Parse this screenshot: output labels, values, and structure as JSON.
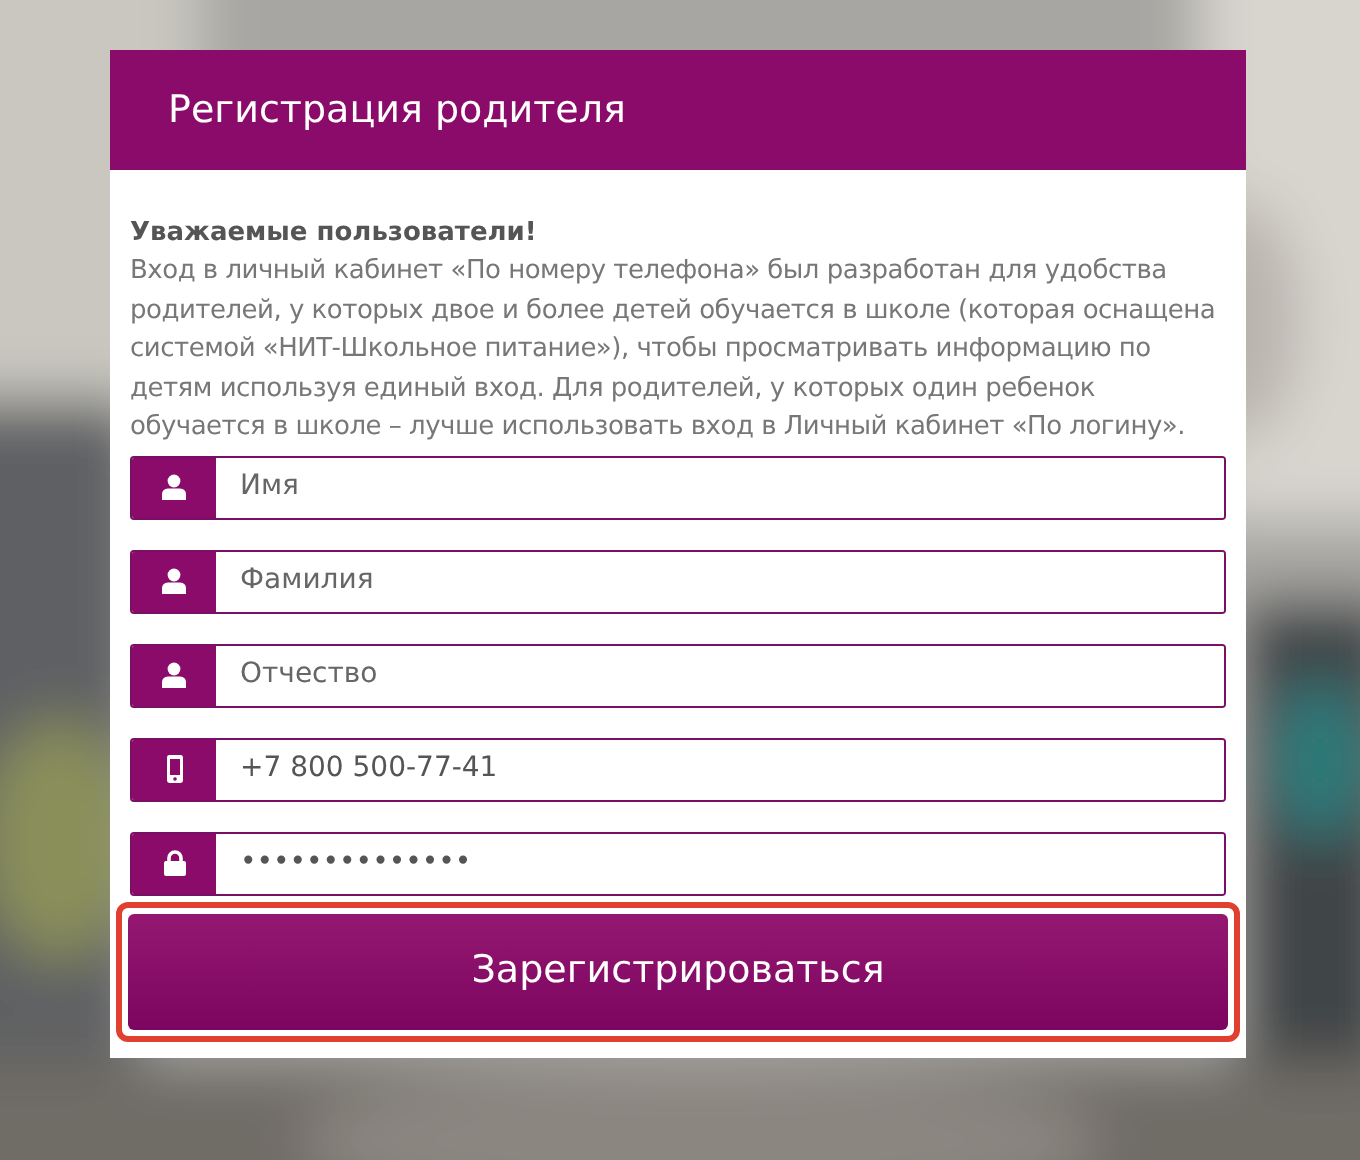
{
  "card": {
    "title": "Регистрация родителя"
  },
  "notice": {
    "heading": "Уважаемые пользователи!",
    "text": "Вход в личный кабинет «По номеру телефона» был разработан для удобства родителей, у которых двое и более детей обучается в школе (которая оснащена системой «НИТ-Школьное питание»), чтобы просматривать информацию по детям используя единый вход. Для родителей, у которых один ребенок обучается в школе – лучше использовать вход в Личный кабинет «По логину»."
  },
  "fields": [
    {
      "kind": "person",
      "placeholder": "Имя"
    },
    {
      "kind": "person",
      "placeholder": "Фамилия"
    },
    {
      "kind": "person",
      "placeholder": "Отчество"
    },
    {
      "kind": "phone",
      "value": "+7 800 500-77-41"
    },
    {
      "kind": "lock",
      "value": "••••••••••••••"
    }
  ],
  "submit": {
    "label": "Зарегистрироваться",
    "highlighted": true
  }
}
